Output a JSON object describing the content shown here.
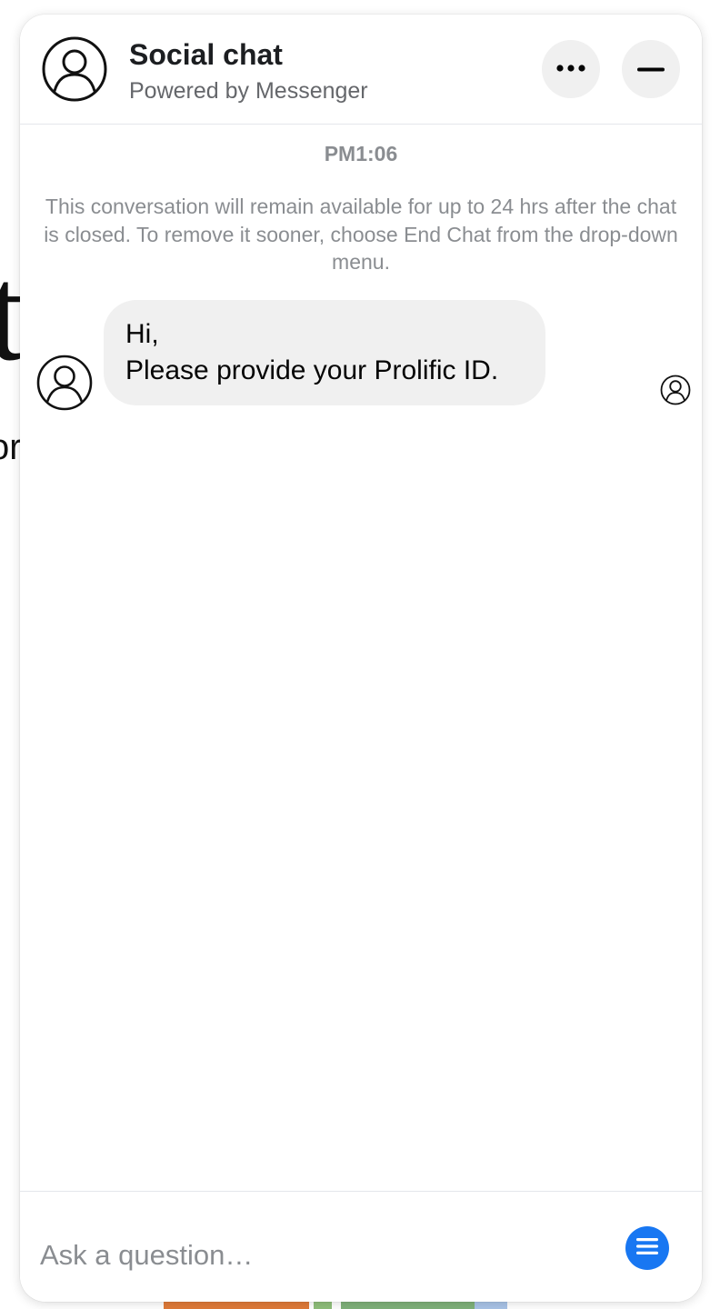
{
  "background": {
    "fragment_large": "t",
    "fragment_small": "or"
  },
  "header": {
    "title": "Social chat",
    "subtitle": "Powered by Messenger",
    "avatar_icon": "user-circle-icon",
    "more_icon": "more-horizontal-icon",
    "minimize_icon": "minus-icon"
  },
  "conversation": {
    "timestamp": "PM1:06",
    "notice": "This conversation will remain available for up to 24 hrs after the chat is closed. To remove it sooner, choose End Chat from the drop-down menu.",
    "messages": [
      {
        "line1": "Hi,",
        "line2": "Please provide your Prolific ID."
      }
    ]
  },
  "composer": {
    "placeholder": "Ask a question…",
    "menu_icon": "menu-icon"
  },
  "colors": {
    "accent": "#1877f2",
    "bubble_bg": "#f0f0f0",
    "muted_text": "#8a8d91"
  }
}
